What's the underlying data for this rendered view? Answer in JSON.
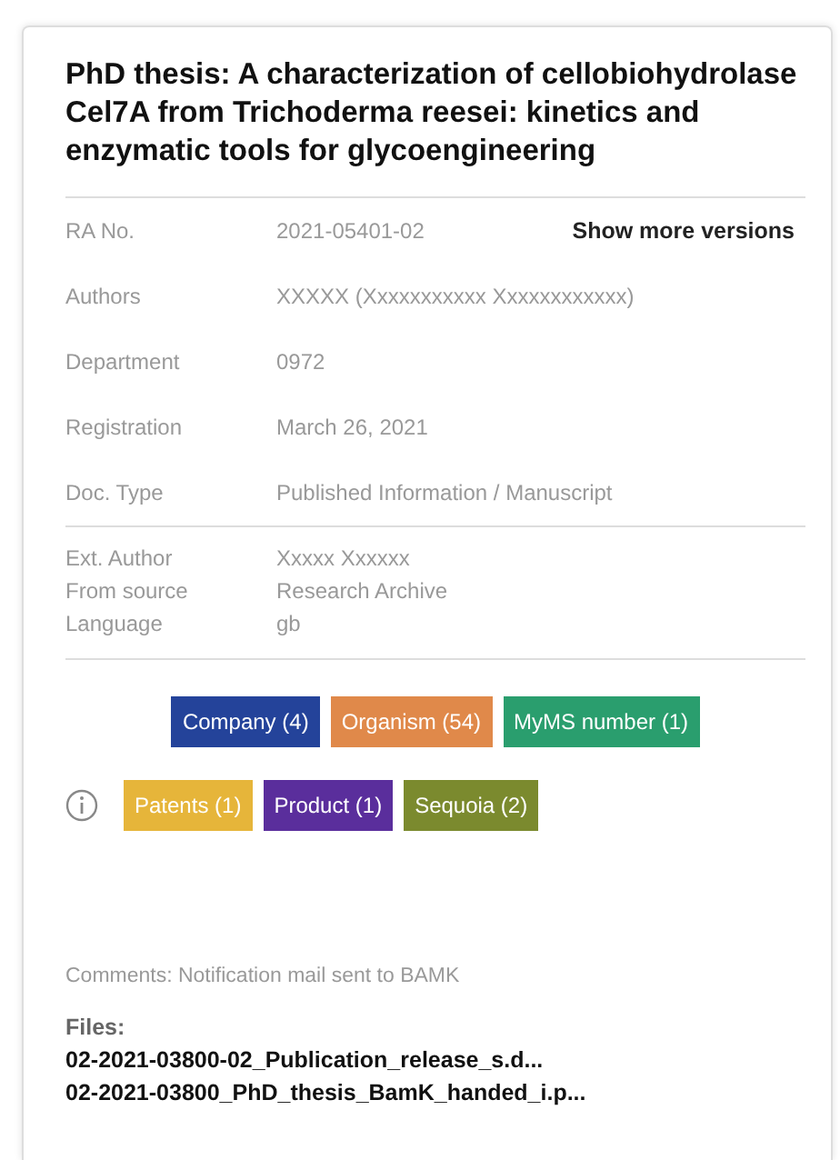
{
  "title": "PhD thesis: A characterization of cellobiohydrolase Cel7A from Trichoderma reesei: kinetics and enzymatic tools for glycoengineering",
  "fields": [
    {
      "label": "RA No.",
      "value": "2021-05401-02"
    },
    {
      "label": "Authors",
      "value": "XXXXX (Xxxxxxxxxxx Xxxxxxxxxxxx)"
    },
    {
      "label": "Department",
      "value": "0972"
    },
    {
      "label": "Registration",
      "value": "March 26, 2021"
    },
    {
      "label": "Doc. Type",
      "value": "Published Information / Manuscript"
    }
  ],
  "show_more": "Show more versions",
  "extra_fields": [
    {
      "label": "Ext. Author",
      "value": "Xxxxx Xxxxxx"
    },
    {
      "label": "From source",
      "value": "Research Archive"
    },
    {
      "label": "Language",
      "value": "gb"
    }
  ],
  "tag_rows": [
    {
      "info_icon": false,
      "tags": [
        {
          "label": "Company (4)",
          "color": "#24439a"
        },
        {
          "label": "Organism (54)",
          "color": "#e0894a"
        },
        {
          "label": "MyMS number (1)",
          "color": "#2a9e6e"
        }
      ]
    },
    {
      "info_icon": true,
      "tags": [
        {
          "label": "Patents (1)",
          "color": "#e6b53a"
        },
        {
          "label": "Product (1)",
          "color": "#5a2e9c"
        },
        {
          "label": "Sequoia (2)",
          "color": "#7b8a2e"
        }
      ]
    }
  ],
  "comments": "Comments: Notification mail sent to BAMK",
  "files_label": "Files:",
  "files": [
    "02-2021-03800-02_Publication_release_s.d...",
    "02-2021-03800_PhD_thesis_BamK_handed_i.p..."
  ]
}
